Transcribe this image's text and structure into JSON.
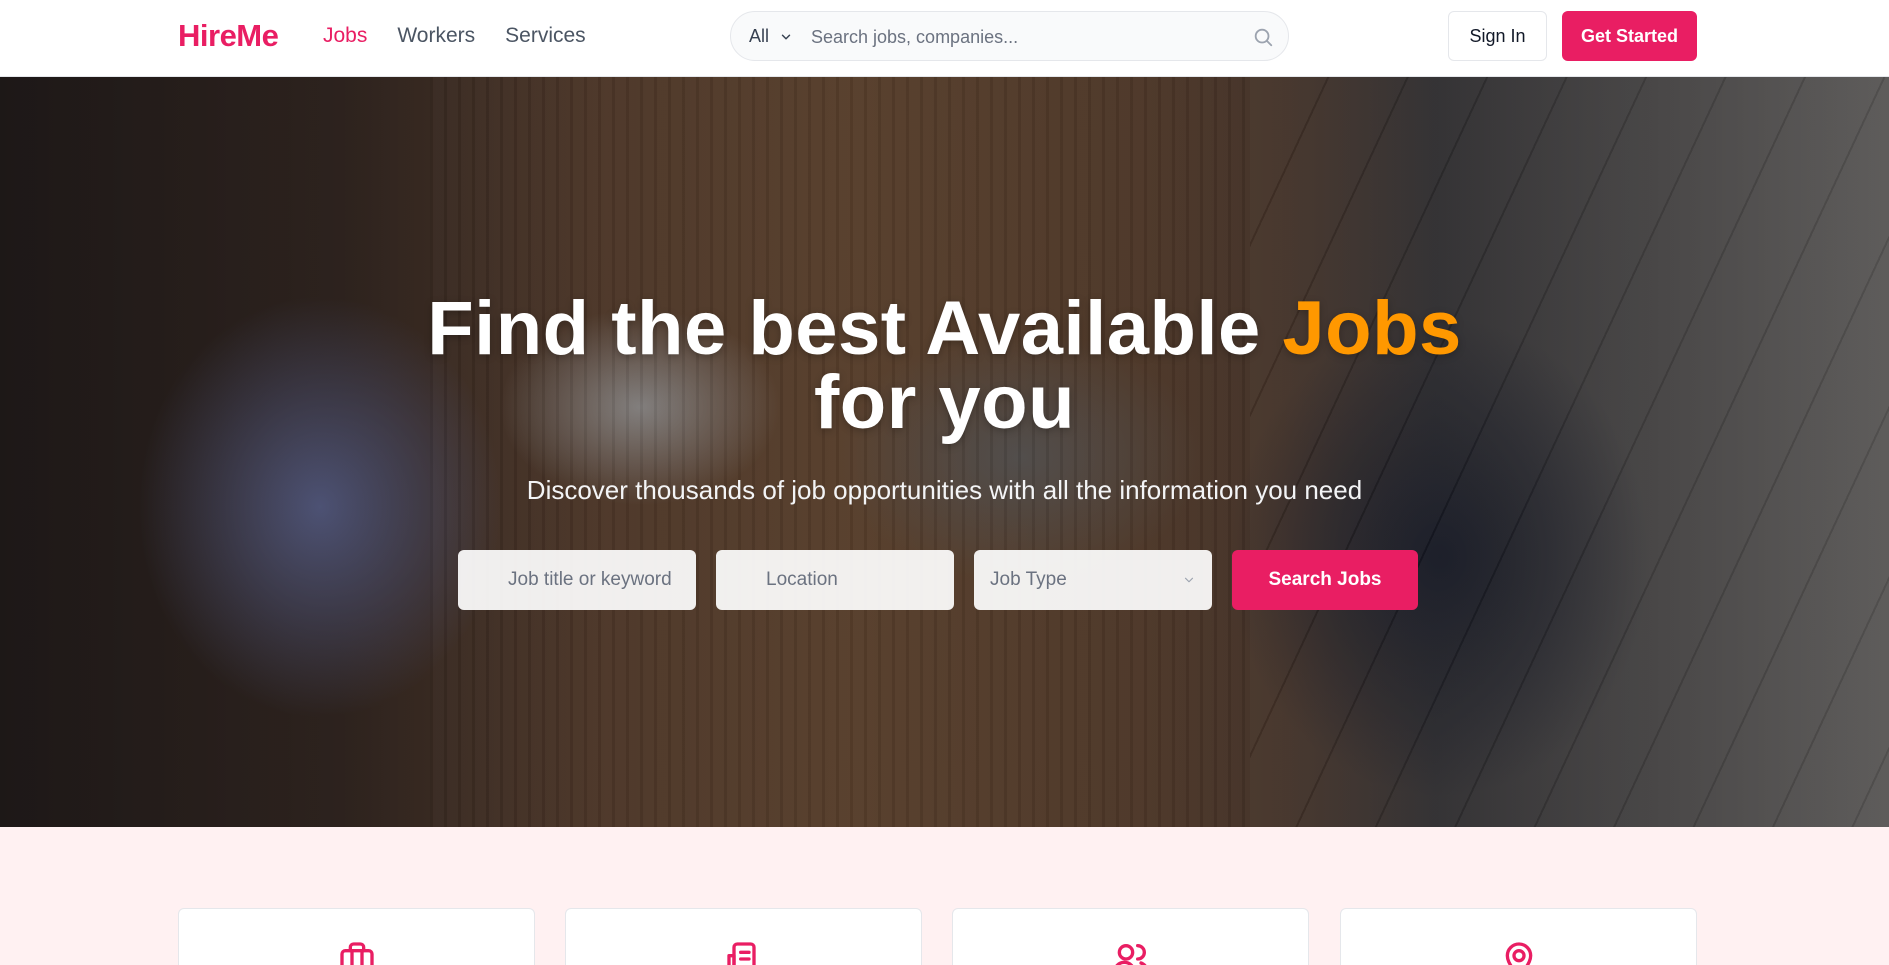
{
  "brand": {
    "name": "HireMe",
    "accent_color": "#e91e63",
    "highlight_color": "#ff9800"
  },
  "nav": {
    "items": [
      "Jobs",
      "Workers",
      "Services"
    ],
    "active": "Jobs"
  },
  "search": {
    "category": "All",
    "placeholder": "Search jobs, companies..."
  },
  "auth": {
    "sign_in": "Sign In",
    "get_started": "Get Started"
  },
  "hero": {
    "title_before": "Find the best Available ",
    "title_highlight": "Jobs",
    "title_after": "for you",
    "subtitle": "Discover thousands of job opportunities with all the information you need",
    "keyword_placeholder": "Job title or keyword",
    "location_placeholder": "Location",
    "job_type_label": "Job Type",
    "search_button": "Search Jobs"
  },
  "features": {
    "cards": [
      {
        "icon": "briefcase-icon"
      },
      {
        "icon": "document-icon"
      },
      {
        "icon": "users-icon"
      },
      {
        "icon": "location-pin-icon"
      }
    ]
  }
}
